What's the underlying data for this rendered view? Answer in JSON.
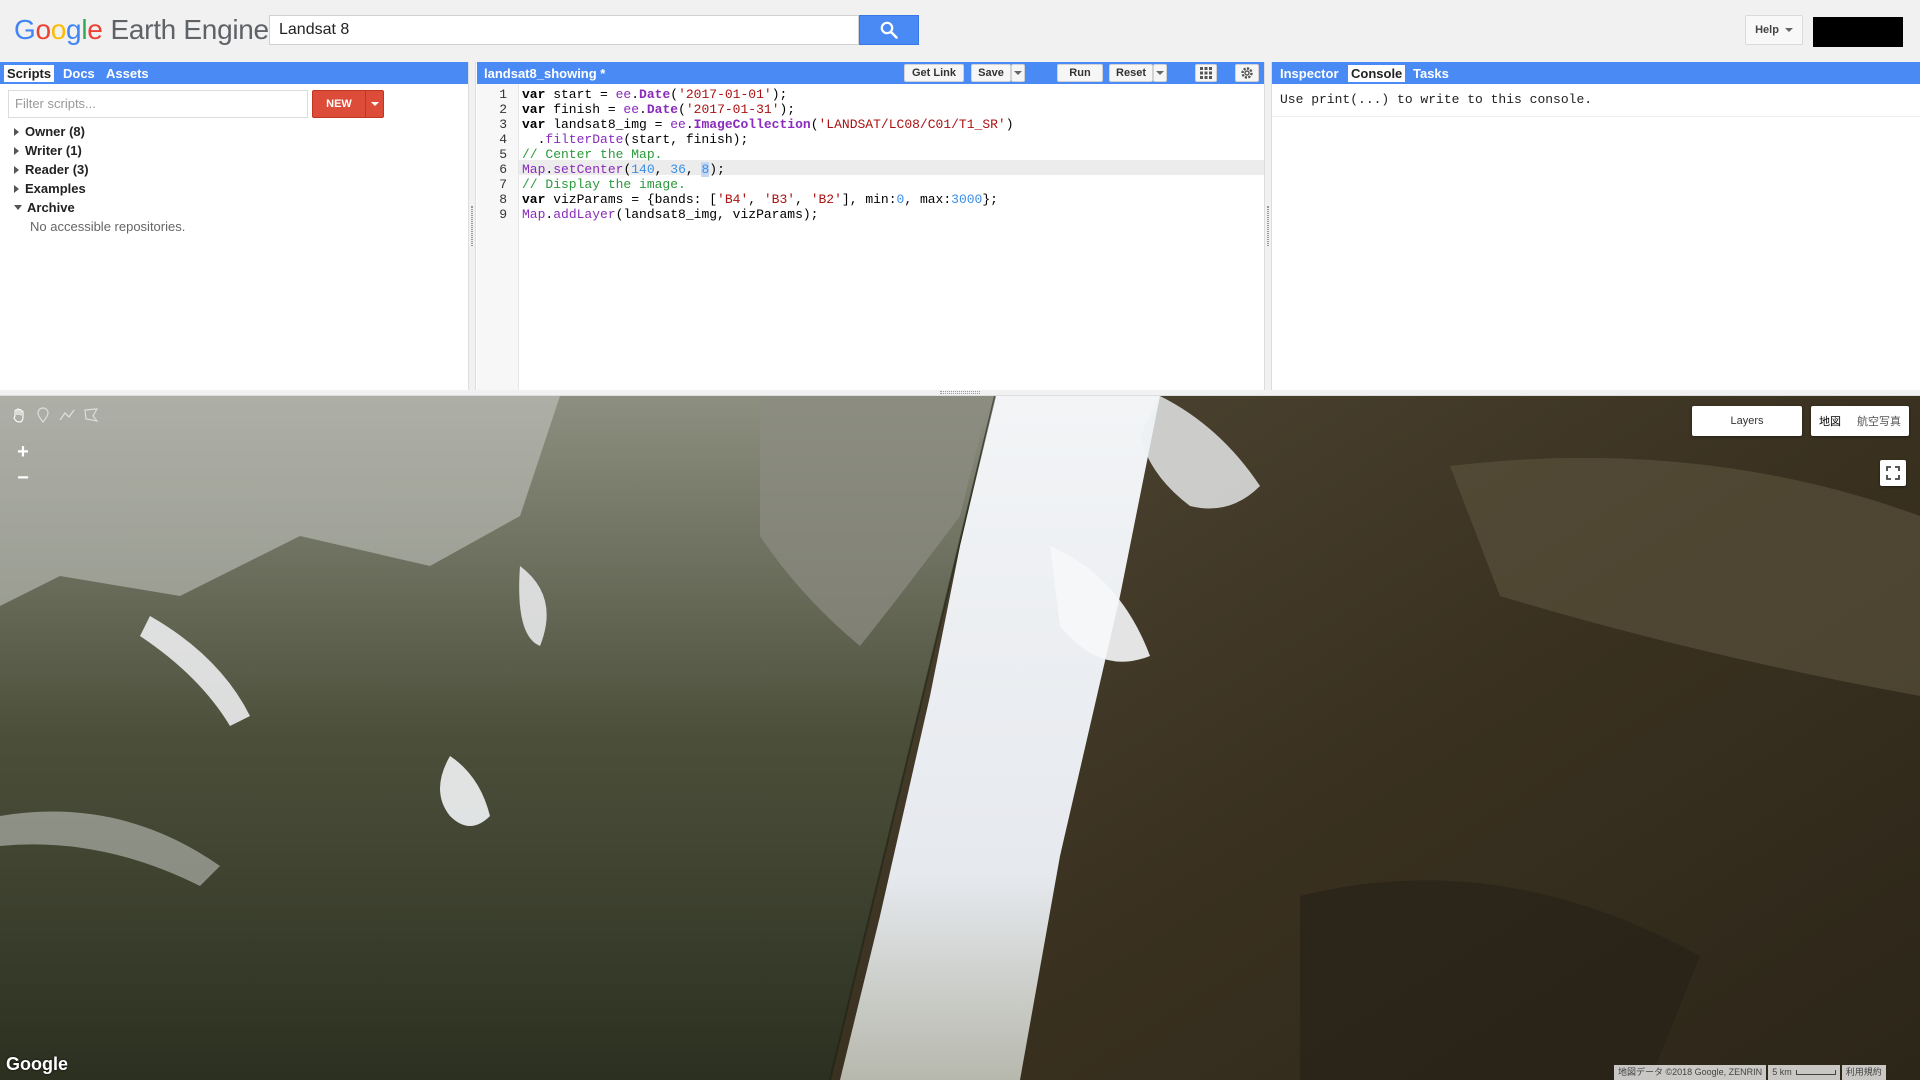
{
  "header": {
    "logo_google": [
      "G",
      "o",
      "o",
      "g",
      "l",
      "e"
    ],
    "logo_product": "Earth Engine",
    "search_value": "Landsat 8",
    "help_label": "Help"
  },
  "left_panel": {
    "tabs": [
      "Scripts",
      "Docs",
      "Assets"
    ],
    "filter_placeholder": "Filter scripts...",
    "new_label": "NEW",
    "tree": [
      {
        "label": "Owner  (8)",
        "expanded": false
      },
      {
        "label": "Writer  (1)",
        "expanded": false
      },
      {
        "label": "Reader  (3)",
        "expanded": false
      },
      {
        "label": "Examples",
        "expanded": false
      },
      {
        "label": "Archive",
        "expanded": true
      }
    ],
    "archive_empty": "No accessible repositories."
  },
  "editor": {
    "title": "landsat8_showing *",
    "buttons": {
      "get_link": "Get Link",
      "save": "Save",
      "run": "Run",
      "reset": "Reset"
    },
    "line_numbers": [
      "1",
      "2",
      "3",
      "4",
      "5",
      "6",
      "7",
      "8",
      "9"
    ]
  },
  "right_panel": {
    "tabs": [
      "Inspector",
      "Console",
      "Tasks"
    ],
    "console_text": "Use print(...) to write to this console."
  },
  "map": {
    "layers_label": "Layers",
    "maptype_map": "地図",
    "maptype_satellite": "航空写真",
    "google_mark": "Google",
    "attribution": "地図データ ©2018 Google, ZENRIN",
    "scale": "5 km",
    "terms": "利用規約"
  },
  "colors": {
    "accent_blue": "#4a8af4",
    "new_button_red": "#dd4b39",
    "header_bg": "#f1f1f1"
  },
  "icons": [
    "search-icon",
    "pan-hand-icon",
    "marker-icon",
    "line-icon",
    "polygon-icon",
    "zoom-in-icon",
    "zoom-out-icon",
    "fullscreen-icon",
    "settings-gear-icon",
    "apps-grid-icon"
  ]
}
